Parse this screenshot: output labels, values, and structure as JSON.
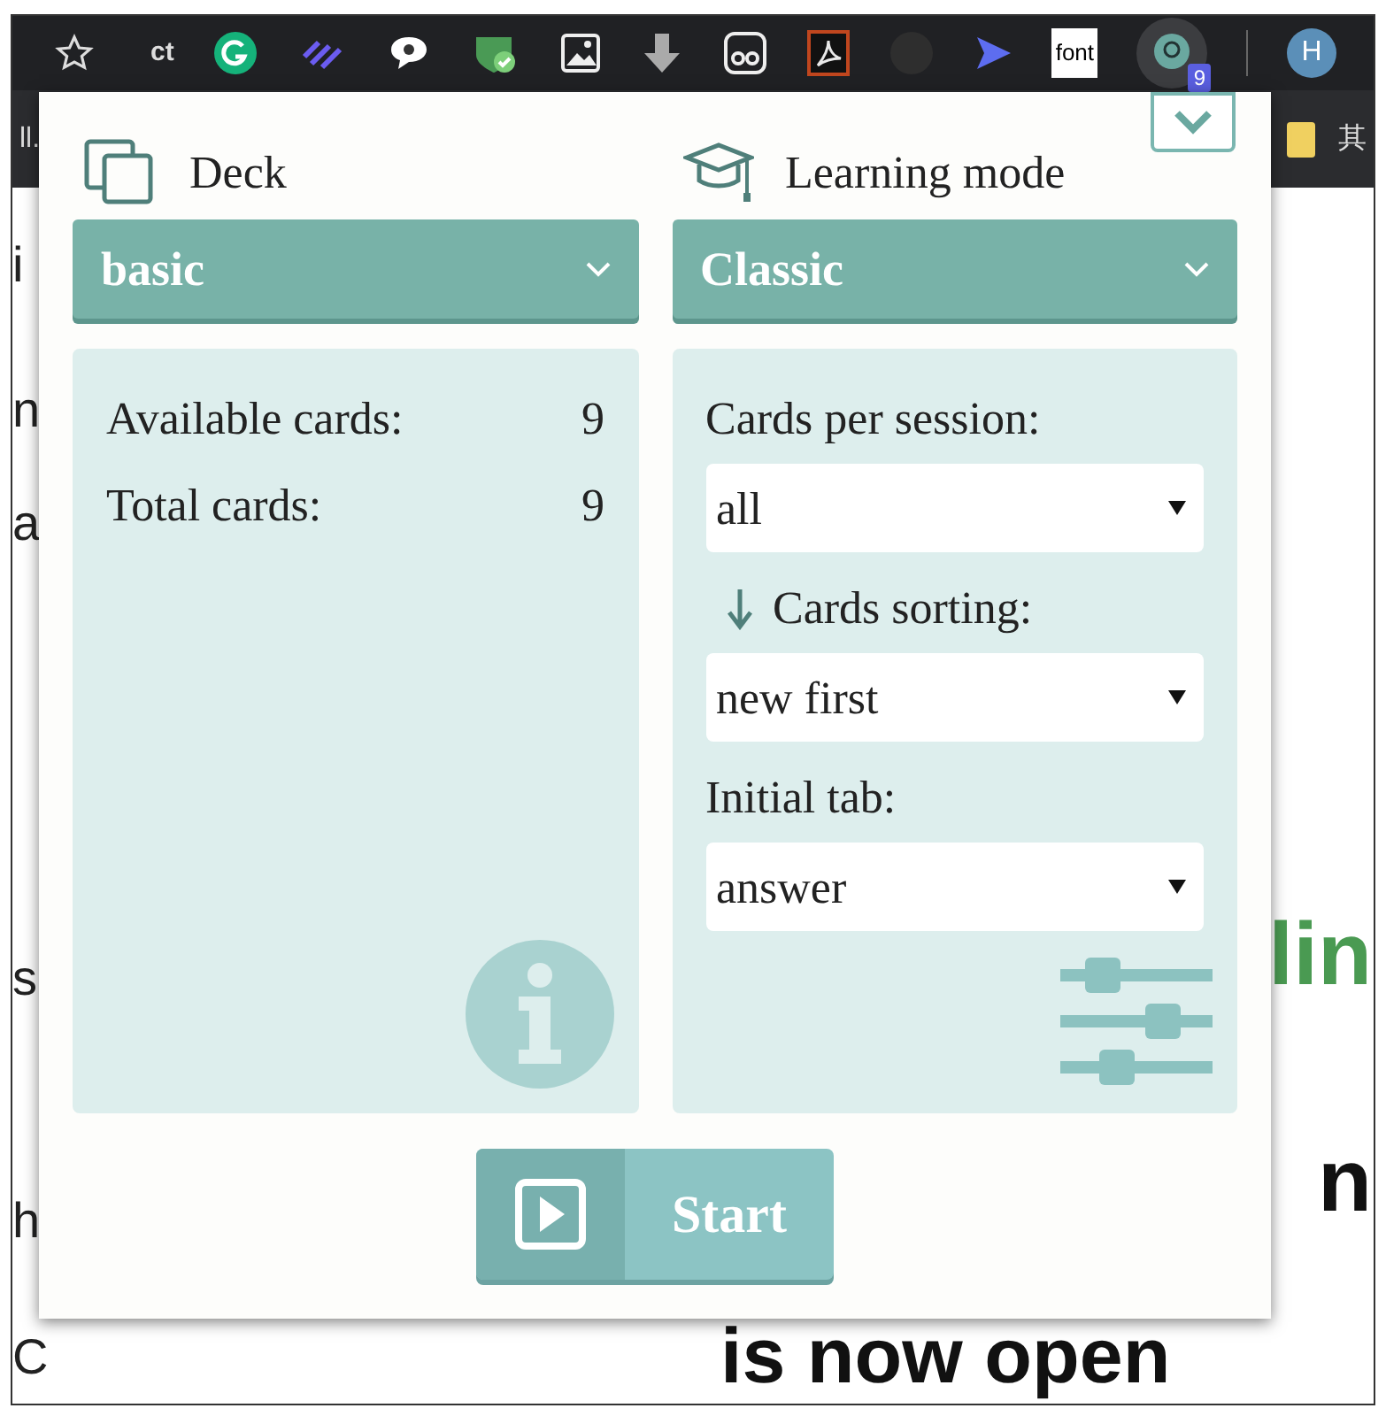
{
  "toolbar": {
    "labels": [
      "ct",
      "font"
    ],
    "badge": "9",
    "avatar": "H"
  },
  "bookmarks": {
    "left": "ll.",
    "right": "其"
  },
  "background_text": {
    "left": [
      "i",
      "n",
      "a",
      "s",
      "h",
      "C"
    ],
    "right": [
      {
        "text": "lin",
        "color": "#4a9a52"
      },
      {
        "text": "n",
        "color": "#111111"
      }
    ],
    "bottom": "is now open"
  },
  "popup": {
    "collapse_button": true,
    "deck": {
      "label": "Deck",
      "value": "basic",
      "stats": [
        {
          "label": "Available cards:",
          "value": "9"
        },
        {
          "label": "Total cards:",
          "value": "9"
        }
      ]
    },
    "mode": {
      "label": "Learning mode",
      "value": "Classic",
      "settings": [
        {
          "kind": "plain",
          "label": "Cards per session:",
          "value": "all"
        },
        {
          "kind": "sorting",
          "label": "Cards sorting:",
          "value": "new first"
        },
        {
          "kind": "plain",
          "label": "Initial tab:",
          "value": "answer"
        }
      ]
    },
    "start": "Start"
  }
}
